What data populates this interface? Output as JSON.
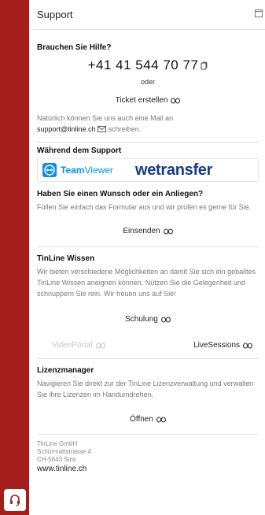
{
  "sidebar": {
    "bg_color": "#a41e1e",
    "icon": "headset-icon"
  },
  "panel": {
    "title": "Support",
    "window_icon": "window-icon"
  },
  "help": {
    "heading": "Brauchen Sie Hilfe?",
    "phone": "+41 41 544 70 77",
    "copy_icon": "copy-icon",
    "or": "oder",
    "ticket_link": "Ticket erstellen",
    "mail_text_1": "Natürlich können Sie uns auch eine Mail an",
    "mail_address": "support@tinline.ch",
    "mail_text_2": "schreiben."
  },
  "during_support": {
    "heading": "Während dem Support",
    "teamviewer_a": "Team",
    "teamviewer_b": "Viewer",
    "wetransfer_a": "we",
    "wetransfer_b": "transfer"
  },
  "wish": {
    "heading": "Haben Sie einen Wunsch oder ein Anliegen?",
    "text": "Füllen Sie einfach das Formular aus und wir prüfen es gerne für Sie.",
    "link": "Einsenden"
  },
  "knowledge": {
    "heading": "TinLine Wissen",
    "text": "Wir bieten verschiedene Möglichkeiten an damit Sie sich ein geballtes TinLine Wissen aneignen können. Nützen Sie die Gelegenheit und schnuppern Sie rein. Wir freuen uns auf Sie!",
    "link_schulung": "Schulung",
    "link_videoportal": "VideoPortal",
    "link_livesessions": "LiveSessions"
  },
  "license": {
    "heading": "Lizenzmanager",
    "text": "Navigieren Sie direkt zur der TinLine Lizenzverwaltung und verwalten Sie ihre Lizenzen im Handumdrehen.",
    "link": "Öffnen"
  },
  "footer": {
    "company": "TinLine GmbH",
    "street": "Schürmattstrasse 4",
    "city": "CH-5643 Sins",
    "url": "www.tinline.ch"
  }
}
